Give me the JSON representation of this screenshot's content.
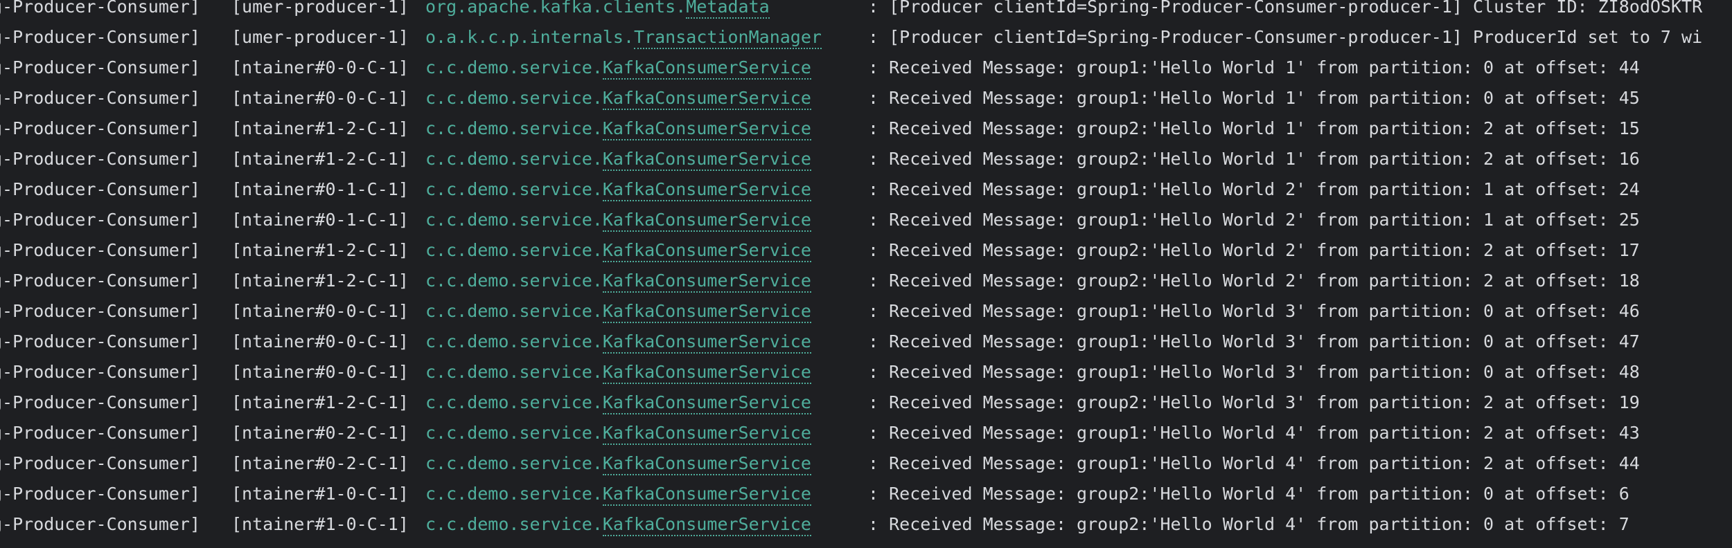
{
  "console": {
    "lines": [
      {
        "app": "g-Producer-Consumer]",
        "thread": "[umer-producer-1]",
        "logger_pkg": "org.apache.kafka.clients.",
        "logger_class": "Metadata",
        "colon": ":",
        "message": "[Producer clientId=Spring-Producer-Consumer-producer-1] Cluster ID: ZI8odOSKTR"
      },
      {
        "app": "g-Producer-Consumer]",
        "thread": "[umer-producer-1]",
        "logger_pkg": "o.a.k.c.p.internals.",
        "logger_class": "TransactionManager",
        "colon": ":",
        "message": "[Producer clientId=Spring-Producer-Consumer-producer-1] ProducerId set to 7 wi"
      },
      {
        "app": "g-Producer-Consumer]",
        "thread": "[ntainer#0-0-C-1]",
        "logger_pkg": "c.c.demo.service.",
        "logger_class": "KafkaConsumerService",
        "colon": ":",
        "message": "Received Message: group1:'Hello World 1' from partition: 0 at offset: 44"
      },
      {
        "app": "g-Producer-Consumer]",
        "thread": "[ntainer#0-0-C-1]",
        "logger_pkg": "c.c.demo.service.",
        "logger_class": "KafkaConsumerService",
        "colon": ":",
        "message": "Received Message: group1:'Hello World 1' from partition: 0 at offset: 45"
      },
      {
        "app": "g-Producer-Consumer]",
        "thread": "[ntainer#1-2-C-1]",
        "logger_pkg": "c.c.demo.service.",
        "logger_class": "KafkaConsumerService",
        "colon": ":",
        "message": "Received Message: group2:'Hello World 1' from partition: 2 at offset: 15"
      },
      {
        "app": "g-Producer-Consumer]",
        "thread": "[ntainer#1-2-C-1]",
        "logger_pkg": "c.c.demo.service.",
        "logger_class": "KafkaConsumerService",
        "colon": ":",
        "message": "Received Message: group2:'Hello World 1' from partition: 2 at offset: 16"
      },
      {
        "app": "g-Producer-Consumer]",
        "thread": "[ntainer#0-1-C-1]",
        "logger_pkg": "c.c.demo.service.",
        "logger_class": "KafkaConsumerService",
        "colon": ":",
        "message": "Received Message: group1:'Hello World 2' from partition: 1 at offset: 24"
      },
      {
        "app": "g-Producer-Consumer]",
        "thread": "[ntainer#0-1-C-1]",
        "logger_pkg": "c.c.demo.service.",
        "logger_class": "KafkaConsumerService",
        "colon": ":",
        "message": "Received Message: group1:'Hello World 2' from partition: 1 at offset: 25"
      },
      {
        "app": "g-Producer-Consumer]",
        "thread": "[ntainer#1-2-C-1]",
        "logger_pkg": "c.c.demo.service.",
        "logger_class": "KafkaConsumerService",
        "colon": ":",
        "message": "Received Message: group2:'Hello World 2' from partition: 2 at offset: 17"
      },
      {
        "app": "g-Producer-Consumer]",
        "thread": "[ntainer#1-2-C-1]",
        "logger_pkg": "c.c.demo.service.",
        "logger_class": "KafkaConsumerService",
        "colon": ":",
        "message": "Received Message: group2:'Hello World 2' from partition: 2 at offset: 18"
      },
      {
        "app": "g-Producer-Consumer]",
        "thread": "[ntainer#0-0-C-1]",
        "logger_pkg": "c.c.demo.service.",
        "logger_class": "KafkaConsumerService",
        "colon": ":",
        "message": "Received Message: group1:'Hello World 3' from partition: 0 at offset: 46"
      },
      {
        "app": "g-Producer-Consumer]",
        "thread": "[ntainer#0-0-C-1]",
        "logger_pkg": "c.c.demo.service.",
        "logger_class": "KafkaConsumerService",
        "colon": ":",
        "message": "Received Message: group1:'Hello World 3' from partition: 0 at offset: 47"
      },
      {
        "app": "g-Producer-Consumer]",
        "thread": "[ntainer#0-0-C-1]",
        "logger_pkg": "c.c.demo.service.",
        "logger_class": "KafkaConsumerService",
        "colon": ":",
        "message": "Received Message: group1:'Hello World 3' from partition: 0 at offset: 48"
      },
      {
        "app": "g-Producer-Consumer]",
        "thread": "[ntainer#1-2-C-1]",
        "logger_pkg": "c.c.demo.service.",
        "logger_class": "KafkaConsumerService",
        "colon": ":",
        "message": "Received Message: group2:'Hello World 3' from partition: 2 at offset: 19"
      },
      {
        "app": "g-Producer-Consumer]",
        "thread": "[ntainer#0-2-C-1]",
        "logger_pkg": "c.c.demo.service.",
        "logger_class": "KafkaConsumerService",
        "colon": ":",
        "message": "Received Message: group1:'Hello World 4' from partition: 2 at offset: 43"
      },
      {
        "app": "g-Producer-Consumer]",
        "thread": "[ntainer#0-2-C-1]",
        "logger_pkg": "c.c.demo.service.",
        "logger_class": "KafkaConsumerService",
        "colon": ":",
        "message": "Received Message: group1:'Hello World 4' from partition: 2 at offset: 44"
      },
      {
        "app": "g-Producer-Consumer]",
        "thread": "[ntainer#1-0-C-1]",
        "logger_pkg": "c.c.demo.service.",
        "logger_class": "KafkaConsumerService",
        "colon": ":",
        "message": "Received Message: group2:'Hello World 4' from partition: 0 at offset: 6"
      },
      {
        "app": "g-Producer-Consumer]",
        "thread": "[ntainer#1-0-C-1]",
        "logger_pkg": "c.c.demo.service.",
        "logger_class": "KafkaConsumerService",
        "colon": ":",
        "message": "Received Message: group2:'Hello World 4' from partition: 0 at offset: 7"
      }
    ]
  },
  "colors": {
    "background": "#1e1f22",
    "text": "#d7d9dd",
    "logger": "#4fae9c"
  }
}
